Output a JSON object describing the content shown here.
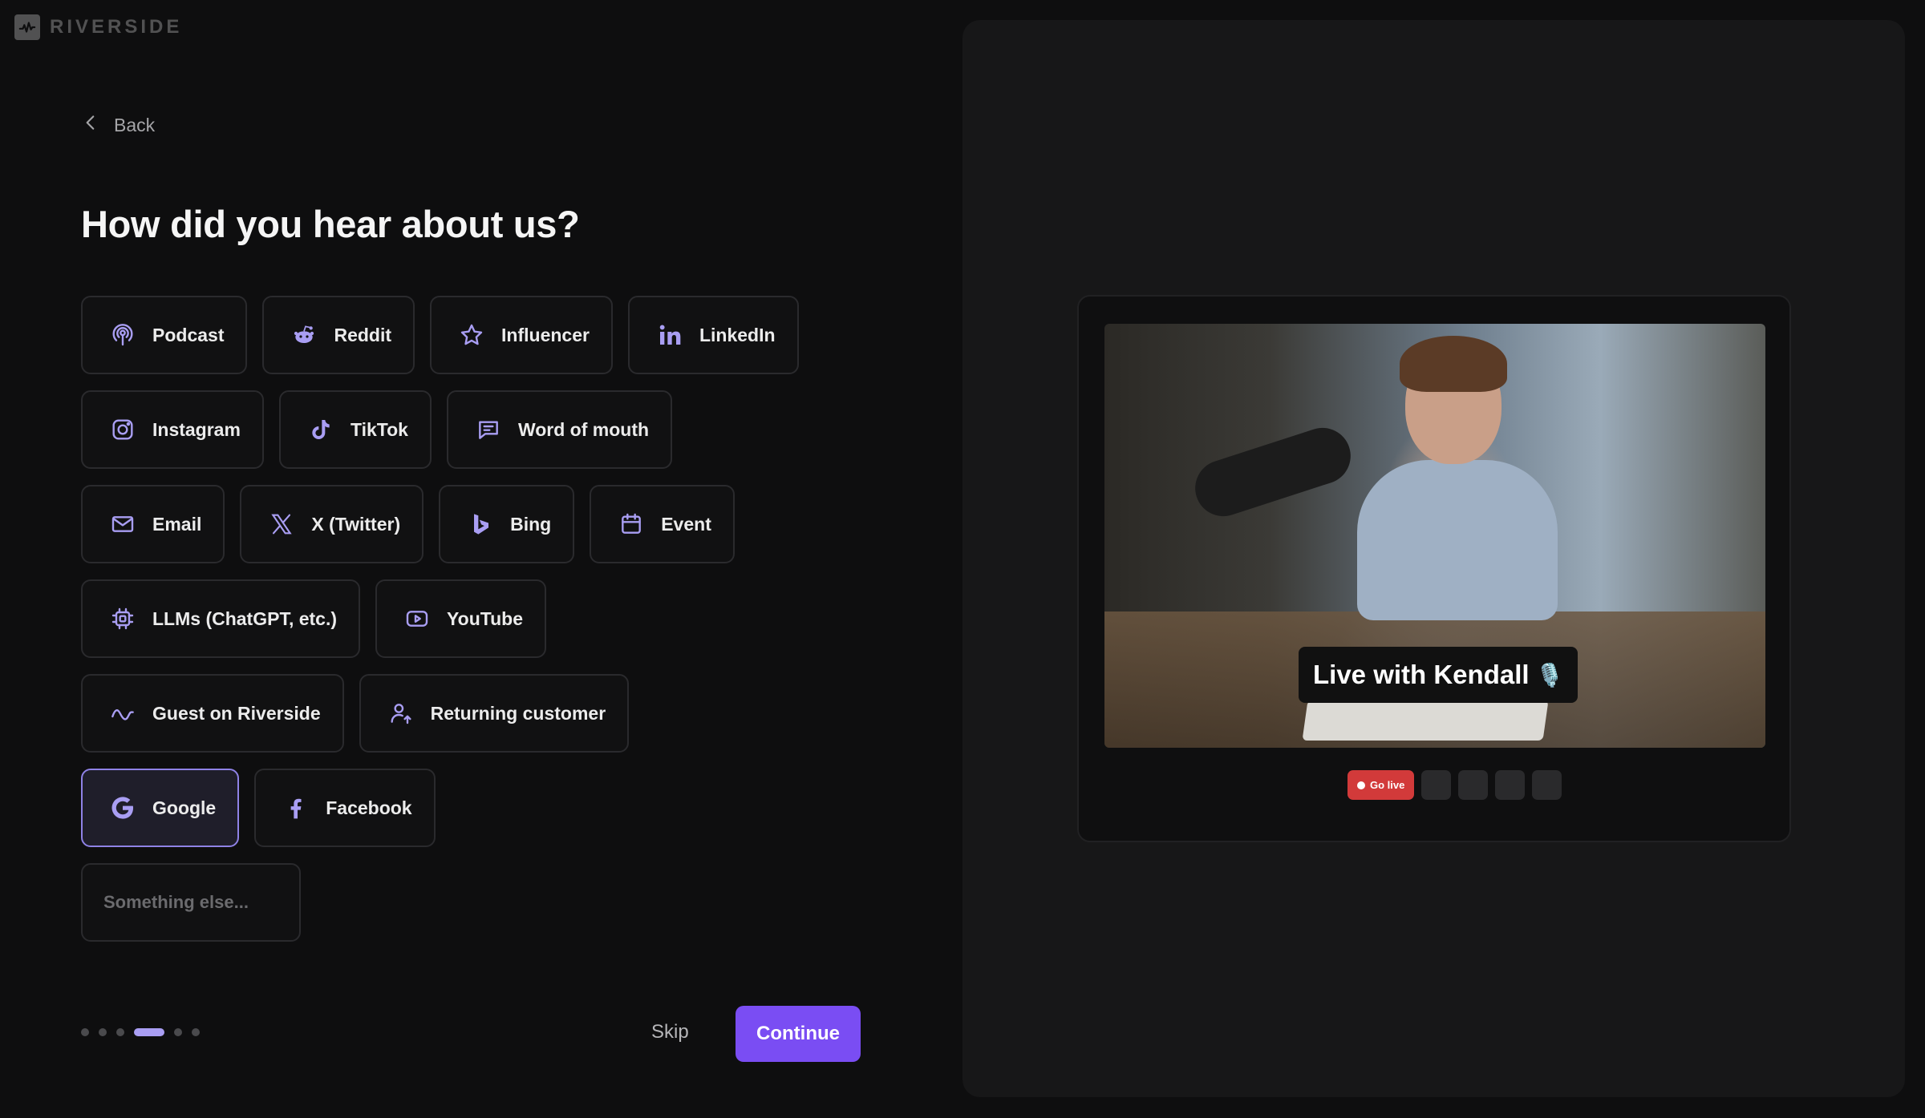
{
  "brand": {
    "name": "RIVERSIDE",
    "logo_icon": "waveform-icon"
  },
  "nav": {
    "back_label": "Back"
  },
  "page_title": "How did you hear about us?",
  "options": [
    [
      {
        "label": "Podcast",
        "icon": "podcast-icon"
      },
      {
        "label": "Reddit",
        "icon": "reddit-icon"
      },
      {
        "label": "Influencer",
        "icon": "star-icon"
      },
      {
        "label": "LinkedIn",
        "icon": "linkedin-icon"
      }
    ],
    [
      {
        "label": "Instagram",
        "icon": "instagram-icon"
      },
      {
        "label": "TikTok",
        "icon": "tiktok-icon"
      },
      {
        "label": "Word of mouth",
        "icon": "message-icon"
      }
    ],
    [
      {
        "label": "Email",
        "icon": "mail-icon"
      },
      {
        "label": "X (Twitter)",
        "icon": "x-icon"
      },
      {
        "label": "Bing",
        "icon": "bing-icon"
      },
      {
        "label": "Event",
        "icon": "calendar-icon"
      }
    ],
    [
      {
        "label": "LLMs (ChatGPT, etc.)",
        "icon": "chip-icon"
      },
      {
        "label": "YouTube",
        "icon": "youtube-icon"
      }
    ],
    [
      {
        "label": "Guest on Riverside",
        "icon": "wave-icon"
      },
      {
        "label": "Returning customer",
        "icon": "user-return-icon"
      }
    ],
    [
      {
        "label": "Google",
        "icon": "google-icon",
        "selected": true
      },
      {
        "label": "Facebook",
        "icon": "facebook-icon"
      }
    ]
  ],
  "something_else": {
    "placeholder": "Something else...",
    "value": ""
  },
  "progress": {
    "total_steps": 6,
    "current_step": 4
  },
  "footer": {
    "skip_label": "Skip",
    "continue_label": "Continue"
  },
  "preview": {
    "caption": "Live with Kendall",
    "caption_emoji": "🎙️",
    "go_live_label": "Go live"
  },
  "colors": {
    "accent": "#7a4df3",
    "accent_soft": "#a99ef3",
    "background": "#0e0e0f",
    "panel": "#171718",
    "live_red": "#d23a3a"
  }
}
